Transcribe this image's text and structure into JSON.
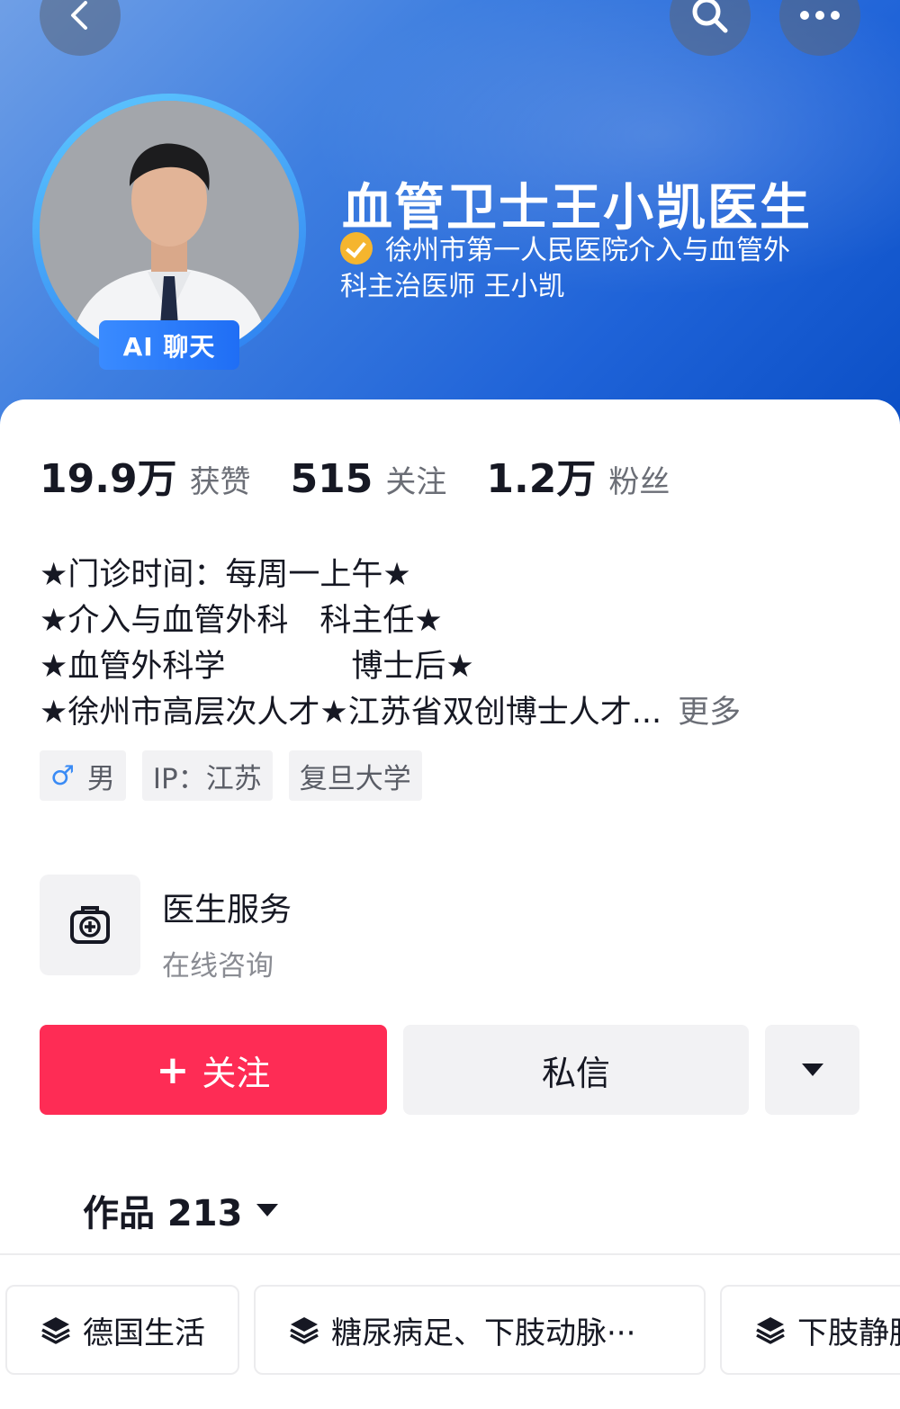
{
  "profile": {
    "name": "血管卫士王小凯医生",
    "cert_line1": "徐州市第一人民医院介入与血管外",
    "cert_line2": "科主治医师 王小凯",
    "ai_badge": "AI 聊天"
  },
  "stats": [
    {
      "value": "19.9万",
      "label": "获赞"
    },
    {
      "value": "515",
      "label": "关注"
    },
    {
      "value": "1.2万",
      "label": "粉丝"
    }
  ],
  "bio": {
    "lines": [
      "★门诊时间：每周一上午★",
      "★介入与血管外科　科主任★",
      "★血管外科学　　　　博士后★",
      "★徐州市高层次人才★江苏省双创博士人才..."
    ],
    "more": "更多"
  },
  "tags": [
    {
      "icon": "male-icon",
      "label": "男"
    },
    {
      "label": "IP：江苏"
    },
    {
      "label": "复旦大学"
    }
  ],
  "service": {
    "icon": "medical-kit-icon",
    "title": "医生服务",
    "subtitle": "在线咨询"
  },
  "actions": {
    "follow": "关注",
    "message": "私信"
  },
  "works": {
    "label": "作品 213"
  },
  "collections": [
    {
      "icon": "layers-icon",
      "label": "德国生活"
    },
    {
      "icon": "layers-icon",
      "label": "糖尿病足、下肢动脉···"
    },
    {
      "icon": "layers-icon",
      "label": "下肢静脉"
    }
  ],
  "colors": {
    "accent": "#fe2c55",
    "header_blue": "#1f63d8",
    "verified": "#f5b52e"
  }
}
